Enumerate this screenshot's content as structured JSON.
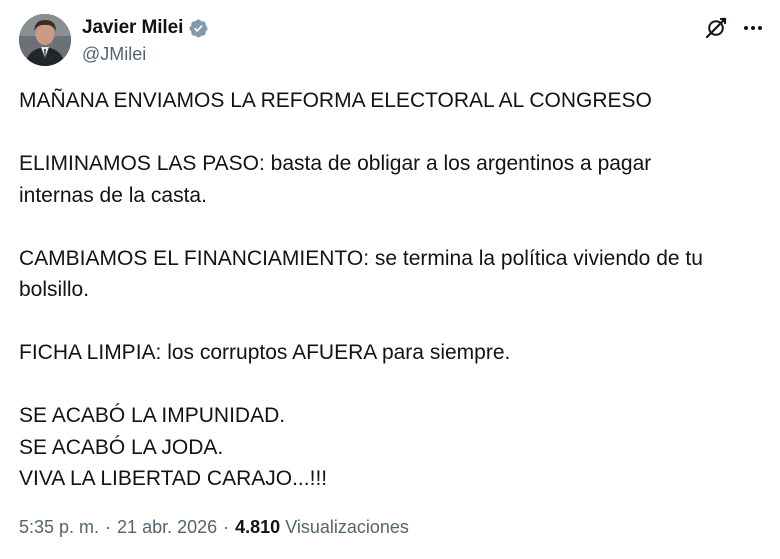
{
  "author": {
    "display_name": "Javier Milei",
    "handle": "@JMilei",
    "verified": true
  },
  "icons": {
    "avatar": "profile-photo",
    "verified": "verified-badge-icon",
    "grok": "grok-icon",
    "more": "more-options-icon"
  },
  "tweet": {
    "line1": "MAÑANA ENVIAMOS LA REFORMA ELECTORAL AL CONGRESO",
    "line2": "ELIMINAMOS LAS PASO: basta de obligar a los argentinos a pagar\ninternas de la casta.",
    "line3": "CAMBIAMOS EL FINANCIAMIENTO: se termina la política viviendo de tu\nbolsillo.",
    "line4": "FICHA LIMPIA: los corruptos AFUERA para siempre.",
    "line5a": "SE ACABÓ LA IMPUNIDAD.",
    "line5b": "SE ACABÓ LA JODA.",
    "line5c": "VIVA LA LIBERTAD CARAJO...!!!"
  },
  "meta": {
    "time": "5:35 p. m.",
    "separator1": "·",
    "date": "21 abr. 2026",
    "separator2": "·",
    "views_count": "4.810",
    "views_label": "Visualizaciones"
  },
  "colors": {
    "text": "#0f1419",
    "secondary": "#536471",
    "verified_badge": "#829aab"
  }
}
